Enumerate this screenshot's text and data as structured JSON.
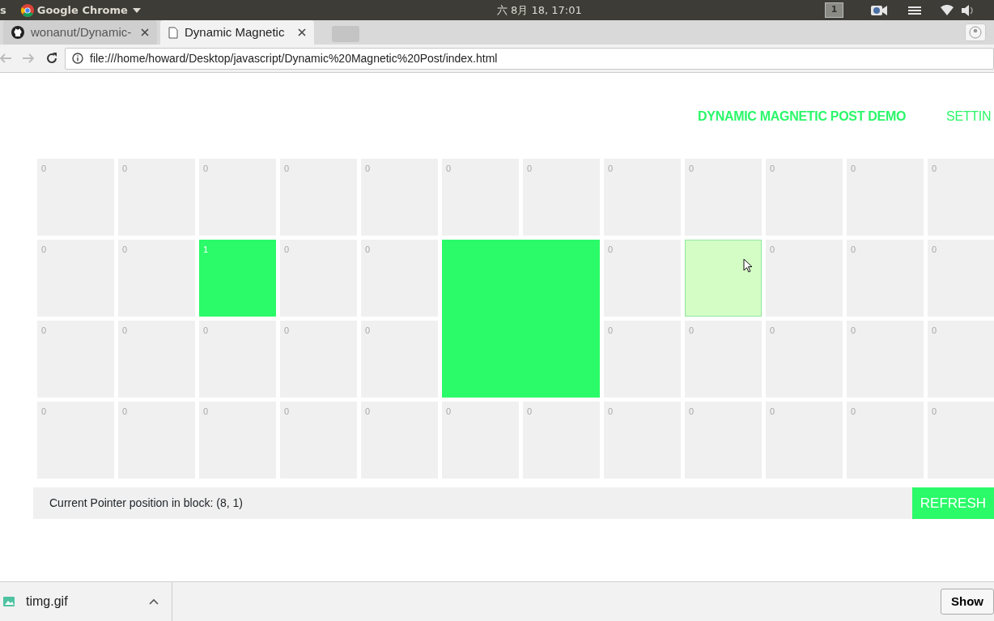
{
  "system_bar": {
    "left_fragment": "s",
    "app_menu": "Google Chrome",
    "clock": "六 8月 18, 17:01",
    "workspace": "1"
  },
  "tabs": [
    {
      "label": "wonanut/Dynamic-",
      "kind": "github",
      "selected": false
    },
    {
      "label": "Dynamic Magnetic",
      "kind": "page",
      "selected": true
    }
  ],
  "address_bar": {
    "url": "file:///home/howard/Desktop/javascript/Dynamic%20Magnetic%20Post/index.html"
  },
  "nav": [
    {
      "label": "DYNAMIC MAGNETIC POST DEMO",
      "selected": true
    },
    {
      "label": "SETTIN",
      "selected": false
    }
  ],
  "grid": {
    "rows": [
      [
        {
          "kind": "empty",
          "value": "0"
        },
        {
          "kind": "empty",
          "value": "0"
        },
        {
          "kind": "empty",
          "value": "0"
        },
        {
          "kind": "empty",
          "value": "0"
        },
        {
          "kind": "empty",
          "value": "0"
        },
        {
          "kind": "empty",
          "value": "0"
        },
        {
          "kind": "empty",
          "value": "0"
        },
        {
          "kind": "empty",
          "value": "0"
        },
        {
          "kind": "empty",
          "value": "0"
        },
        {
          "kind": "empty",
          "value": "0"
        },
        {
          "kind": "empty",
          "value": "0"
        },
        {
          "kind": "empty",
          "value": "0"
        }
      ],
      [
        {
          "kind": "empty",
          "value": "0"
        },
        {
          "kind": "empty",
          "value": "0"
        },
        {
          "kind": "filled",
          "value": "1"
        },
        {
          "kind": "empty",
          "value": "0"
        },
        {
          "kind": "empty",
          "value": "0"
        },
        {
          "kind": "merged"
        },
        "",
        {
          "kind": "empty",
          "value": "0"
        },
        {
          "kind": "hover"
        },
        {
          "kind": "empty",
          "value": "0"
        },
        {
          "kind": "empty",
          "value": "0"
        },
        {
          "kind": "empty",
          "value": "0"
        }
      ],
      [
        {
          "kind": "empty",
          "value": "0"
        },
        {
          "kind": "empty",
          "value": "0"
        },
        {
          "kind": "empty",
          "value": "0"
        },
        {
          "kind": "empty",
          "value": "0"
        },
        {
          "kind": "empty",
          "value": "0"
        },
        "",
        "",
        {
          "kind": "empty",
          "value": "0"
        },
        {
          "kind": "empty",
          "value": "0"
        },
        {
          "kind": "empty",
          "value": "0"
        },
        {
          "kind": "empty",
          "value": "0"
        },
        {
          "kind": "empty",
          "value": "0"
        }
      ],
      [
        {
          "kind": "empty",
          "value": "0"
        },
        {
          "kind": "empty",
          "value": "0"
        },
        {
          "kind": "empty",
          "value": "0"
        },
        {
          "kind": "empty",
          "value": "0"
        },
        {
          "kind": "empty",
          "value": "0"
        },
        {
          "kind": "empty",
          "value": "0"
        },
        {
          "kind": "empty",
          "value": "0"
        },
        {
          "kind": "empty",
          "value": "0"
        },
        {
          "kind": "empty",
          "value": "0"
        },
        {
          "kind": "empty",
          "value": "0"
        },
        {
          "kind": "empty",
          "value": "0"
        },
        {
          "kind": "empty",
          "value": "0"
        }
      ]
    ]
  },
  "status": {
    "text": "Current Pointer position in block: (8, 1)",
    "button": "REFRESH"
  },
  "download_bar": {
    "file": "timg.gif",
    "button": "Show"
  }
}
